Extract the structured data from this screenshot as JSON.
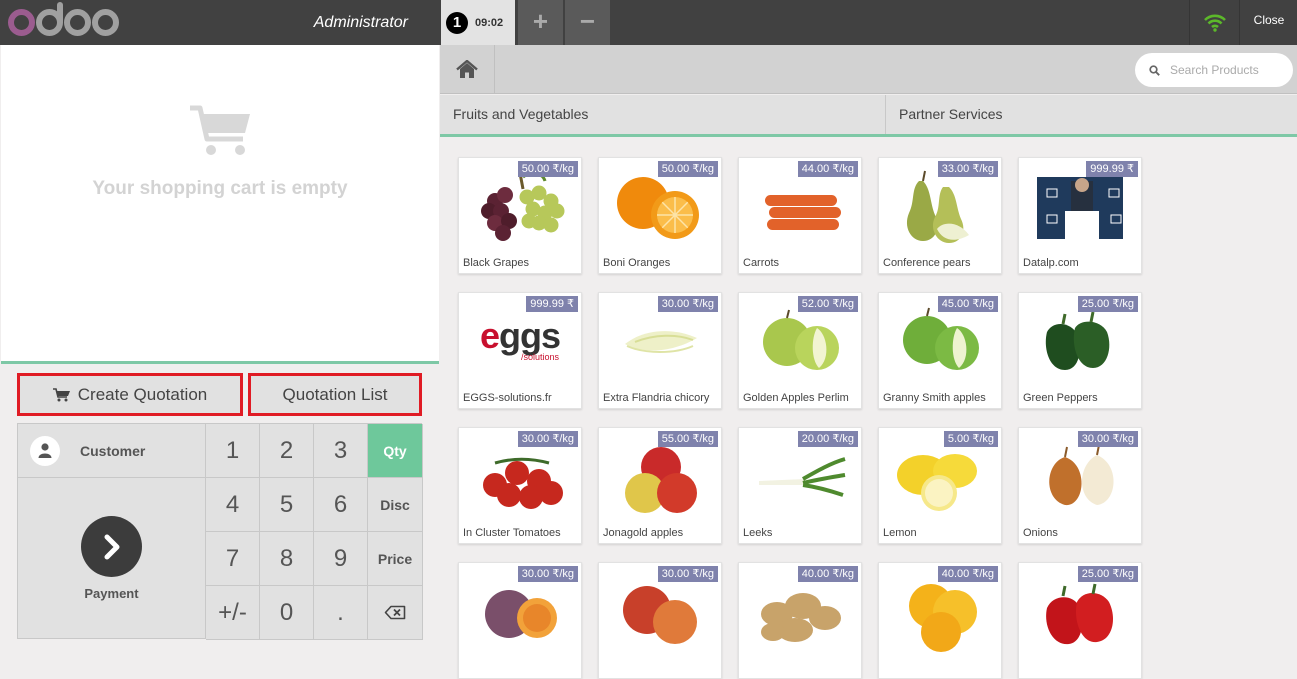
{
  "app": {
    "user": "Administrator",
    "close_label": "Close"
  },
  "orders": {
    "active_number": "1",
    "active_time": "09:02",
    "add_symbol": "+",
    "remove_symbol": "−"
  },
  "cart": {
    "empty_message": "Your shopping cart is empty"
  },
  "quotation": {
    "create_label": "Create Quotation",
    "list_label": "Quotation List"
  },
  "actionpad": {
    "customer_label": "Customer",
    "payment_label": "Payment"
  },
  "numpad": {
    "keys": [
      "1",
      "2",
      "3",
      "Qty",
      "4",
      "5",
      "6",
      "Disc",
      "7",
      "8",
      "9",
      "Price",
      "+/-",
      "0",
      ".",
      ""
    ],
    "active_mode": "Qty"
  },
  "search": {
    "placeholder": "Search Products"
  },
  "categories": [
    "Fruits and Vegetables",
    "Partner Services"
  ],
  "products": [
    {
      "name": "Black Grapes",
      "price": "50.00 ₹/kg",
      "icon": "grapes"
    },
    {
      "name": "Boni Oranges",
      "price": "50.00 ₹/kg",
      "icon": "oranges"
    },
    {
      "name": "Carrots",
      "price": "44.00 ₹/kg",
      "icon": "carrots"
    },
    {
      "name": "Conference pears",
      "price": "33.00 ₹/kg",
      "icon": "pears"
    },
    {
      "name": "Datalp.com",
      "price": "999.99 ₹",
      "icon": "datalp"
    },
    {
      "name": "EGGS-solutions.fr",
      "price": "999.99 ₹",
      "icon": "eggs-logo",
      "logo_text": "eggs",
      "logo_sub": "/solutions"
    },
    {
      "name": "Extra Flandria chicory",
      "price": "30.00 ₹/kg",
      "icon": "chicory"
    },
    {
      "name": "Golden Apples Perlim",
      "price": "52.00 ₹/kg",
      "icon": "golden-apples"
    },
    {
      "name": "Granny Smith apples",
      "price": "45.00 ₹/kg",
      "icon": "granny-apples"
    },
    {
      "name": "Green Peppers",
      "price": "25.00 ₹/kg",
      "icon": "green-peppers"
    },
    {
      "name": "In Cluster Tomatoes",
      "price": "30.00 ₹/kg",
      "icon": "tomatoes"
    },
    {
      "name": "Jonagold apples",
      "price": "55.00 ₹/kg",
      "icon": "jonagold-apples"
    },
    {
      "name": "Leeks",
      "price": "20.00 ₹/kg",
      "icon": "leeks"
    },
    {
      "name": "Lemon",
      "price": "5.00 ₹/kg",
      "icon": "lemons"
    },
    {
      "name": "Onions",
      "price": "30.00 ₹/kg",
      "icon": "onions"
    },
    {
      "name": "",
      "price": "30.00 ₹/kg",
      "icon": "passion-fruit"
    },
    {
      "name": "",
      "price": "30.00 ₹/kg",
      "icon": "peaches"
    },
    {
      "name": "",
      "price": "40.00 ₹/kg",
      "icon": "potatoes"
    },
    {
      "name": "",
      "price": "40.00 ₹/kg",
      "icon": "grapefruit"
    },
    {
      "name": "",
      "price": "25.00 ₹/kg",
      "icon": "red-peppers"
    }
  ],
  "colors": {
    "accent": "#7ec8a6",
    "price_tag": "#7f82ac",
    "highlight_border": "#e01b24",
    "topbar": "#414141",
    "wifi": "#5cb82a"
  }
}
